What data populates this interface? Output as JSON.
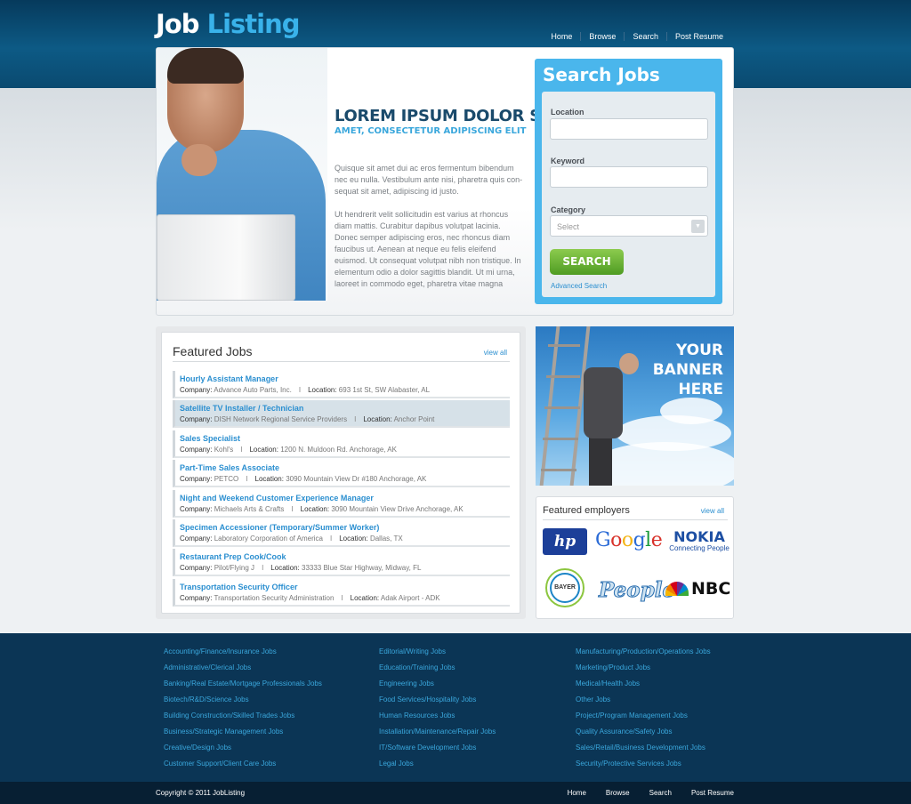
{
  "header": {
    "logo_word1": "Job",
    "logo_word2": "Listing",
    "nav": [
      "Home",
      "Browse",
      "Search",
      "Post Resume"
    ]
  },
  "hero": {
    "title": "LOREM IPSUM DOLOR SIT",
    "subtitle": "AMET, CONSECTETUR ADIPISCING ELIT",
    "paragraph1": "Quisque sit amet dui ac eros fermentum bibendum nec eu nulla. Vestibulum ante nisi, pharetra quis con-sequat sit amet, adipiscing id justo.",
    "paragraph2": "Ut hendrerit velit sollicitudin est varius at rhoncus diam mattis. Curabitur dapibus volutpat lacinia. Donec semper adipiscing eros, nec rhoncus diam faucibus ut. Aenean at neque eu felis eleifend euismod. Ut consequat volutpat nibh non tristique. In elementum odio a dolor sagittis blandit. Ut mi urna, laoreet in commodo eget, pharetra vitae magna"
  },
  "search": {
    "title": "Search Jobs",
    "location_label": "Location",
    "location_value": "",
    "keyword_label": "Keyword",
    "keyword_value": "",
    "category_label": "Category",
    "category_selected": "Select",
    "button": "SEARCH",
    "advanced": "Advanced Search"
  },
  "featured_jobs": {
    "title": "Featured Jobs",
    "view_all": "view all",
    "company_label": "Company:",
    "location_label": "Location:",
    "separator": "I",
    "jobs": [
      {
        "title": "Hourly Assistant Manager",
        "company": "Advance Auto Parts, Inc.",
        "location": "693 1st St, SW Alabaster, AL"
      },
      {
        "title": "Satellite TV Installer / Technician",
        "company": "DISH Network Regional Service Providers",
        "location": "Anchor Point"
      },
      {
        "title": "Sales Specialist",
        "company": "Kohl's",
        "location": "1200 N. Muldoon Rd. Anchorage, AK"
      },
      {
        "title": "Part-Time Sales Associate",
        "company": "PETCO",
        "location": "3090 Mountain View Dr #180 Anchorage, AK"
      },
      {
        "title": "Night and Weekend Customer Experience Manager",
        "company": "Michaels Arts & Crafts",
        "location": "3090 Mountain View Drive Anchorage, AK"
      },
      {
        "title": "Specimen Accessioner (Temporary/Summer Worker)",
        "company": "Laboratory Corporation of America",
        "location": "Dallas, TX"
      },
      {
        "title": "Restaurant Prep Cook/Cook",
        "company": "Pilot/Flying J",
        "location": "33333 Blue Star Highway, Midway, FL"
      },
      {
        "title": "Transportation Security Officer",
        "company": "Transportation Security Administration",
        "location": "Adak Airport - ADK"
      }
    ]
  },
  "banner": {
    "line1": "YOUR",
    "line2": "BANNER",
    "line3": "HERE"
  },
  "employers": {
    "title": "Featured employers",
    "view_all": "view all",
    "logos": {
      "hp": "hp",
      "google": "Google",
      "nokia1": "NOKIA",
      "nokia2": "Connecting People",
      "bayer": "BAYER",
      "people": "People",
      "nbc": "NBC"
    }
  },
  "footer": {
    "col1": [
      "Accounting/Finance/Insurance Jobs",
      "Administrative/Clerical Jobs",
      "Banking/Real Estate/Mortgage Professionals Jobs",
      "Biotech/R&D/Science Jobs",
      "Building Construction/Skilled Trades Jobs",
      "Business/Strategic Management Jobs",
      "Creative/Design Jobs",
      "Customer Support/Client Care Jobs"
    ],
    "col2": [
      "Editorial/Writing Jobs",
      "Education/Training Jobs",
      "Engineering Jobs",
      "Food Services/Hospitality Jobs",
      "Human Resources Jobs",
      "Installation/Maintenance/Repair Jobs",
      "IT/Software Development Jobs",
      "Legal Jobs"
    ],
    "col3": [
      "Manufacturing/Production/Operations Jobs",
      "Marketing/Product Jobs",
      "Medical/Health Jobs",
      "Other Jobs",
      "Project/Program Management Jobs",
      "Quality Assurance/Safety Jobs",
      "Sales/Retail/Business Development Jobs",
      "Security/Protective Services Jobs"
    ],
    "copyright": "Copyright © 2011 JobListing",
    "nav": [
      "Home",
      "Browse",
      "Search",
      "Post Resume"
    ]
  },
  "colors": {
    "accent": "#39b2ea",
    "header_dark": "#063a5c",
    "search_panel": "#4ab6ec",
    "button_green": "#5fa92f",
    "footer": "#0b3555"
  }
}
